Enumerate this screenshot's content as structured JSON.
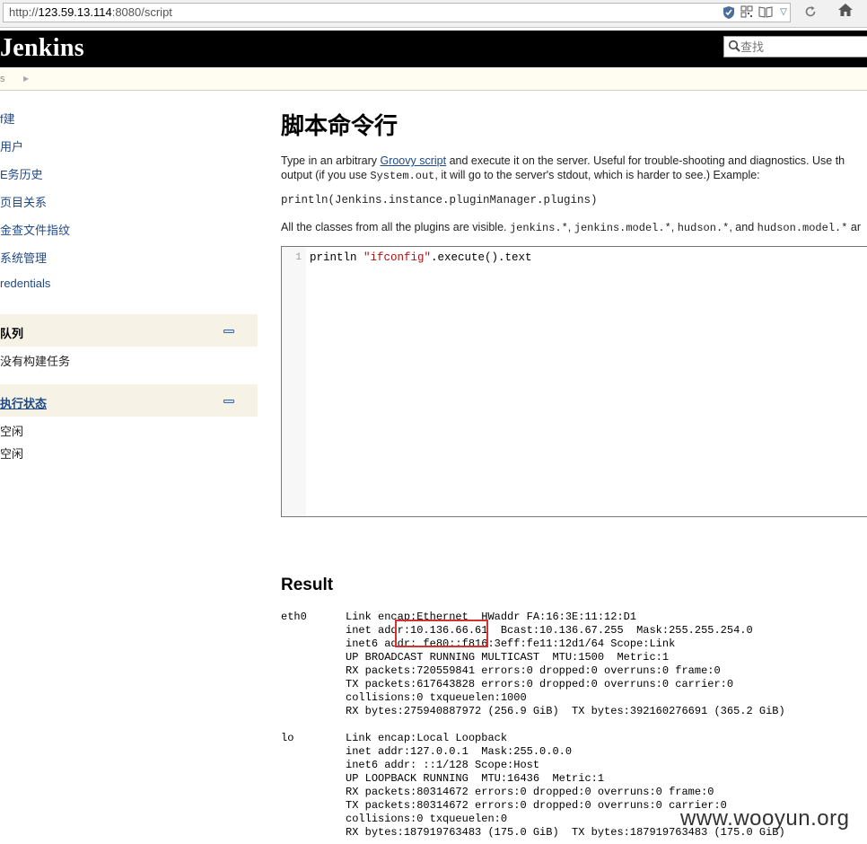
{
  "browser": {
    "url_prefix": "http://",
    "url_host": "123.59.13.114",
    "url_rest": ":8080/script",
    "home_icon": "home-icon"
  },
  "header": {
    "title": "Jenkins",
    "search_placeholder": "查找"
  },
  "breadcrumb": {
    "item": "s"
  },
  "sidebar": {
    "links": [
      {
        "label": "f建"
      },
      {
        "label": "用户"
      },
      {
        "label": "E务历史"
      },
      {
        "label": "页目关系"
      },
      {
        "label": "金查文件指纹"
      },
      {
        "label": "系统管理"
      },
      {
        "label": "redentials"
      }
    ],
    "queue": {
      "title": "队列",
      "empty": "没有构建任务"
    },
    "executors": {
      "title": "执行状态",
      "rows": [
        "空闲",
        "空闲"
      ]
    }
  },
  "main": {
    "title": "脚本命令行",
    "intro_1a": "Type in an arbitrary ",
    "intro_link": "Groovy script",
    "intro_1b": " and execute it on the server. Useful for trouble-shooting and diagnostics. Use th",
    "intro_2a": "output (if you use ",
    "intro_2code": "System.out",
    "intro_2b": ", it will go to the server's stdout, which is harder to see.) Example:",
    "example": "println(Jenkins.instance.pluginManager.plugins)",
    "classes_a": "All the classes from all the plugins are visible. ",
    "classes_c1": "jenkins.*",
    "classes_sep1": ", ",
    "classes_c2": "jenkins.model.*",
    "classes_sep2": ", ",
    "classes_c3": "hudson.*",
    "classes_and": ", and ",
    "classes_c4": "hudson.model.*",
    "classes_b": " ar",
    "editor": {
      "line_number": "1",
      "code_a": "println ",
      "code_str": "\"ifconfig\"",
      "code_b": ".execute().text"
    },
    "result_title": "Result",
    "output": [
      "eth0      Link encap:Ethernet  HWaddr FA:16:3E:11:12:D1",
      "          inet addr:10.136.66.61  Bcast:10.136.67.255  Mask:255.255.254.0",
      "          inet6 addr: fe80::f816:3eff:fe11:12d1/64 Scope:Link",
      "          UP BROADCAST RUNNING MULTICAST  MTU:1500  Metric:1",
      "          RX packets:720559841 errors:0 dropped:0 overruns:0 frame:0",
      "          TX packets:617643828 errors:0 dropped:0 overruns:0 carrier:0",
      "          collisions:0 txqueuelen:1000",
      "          RX bytes:275940887972 (256.9 GiB)  TX bytes:392160276691 (365.2 GiB)",
      "",
      "lo        Link encap:Local Loopback",
      "          inet addr:127.0.0.1  Mask:255.0.0.0",
      "          inet6 addr: ::1/128 Scope:Host",
      "          UP LOOPBACK RUNNING  MTU:16436  Metric:1",
      "          RX packets:80314672 errors:0 dropped:0 overruns:0 frame:0",
      "          TX packets:80314672 errors:0 dropped:0 overruns:0 carrier:0",
      "          collisions:0 txqueuelen:0",
      "          RX bytes:187919763483 (175.0 GiB)  TX bytes:187919763483 (175.0 GiB)"
    ]
  },
  "watermark": "www.wooyun.org",
  "colors": {
    "header_bg": "#000000",
    "link": "#204a87",
    "highlight": "#d63030"
  }
}
